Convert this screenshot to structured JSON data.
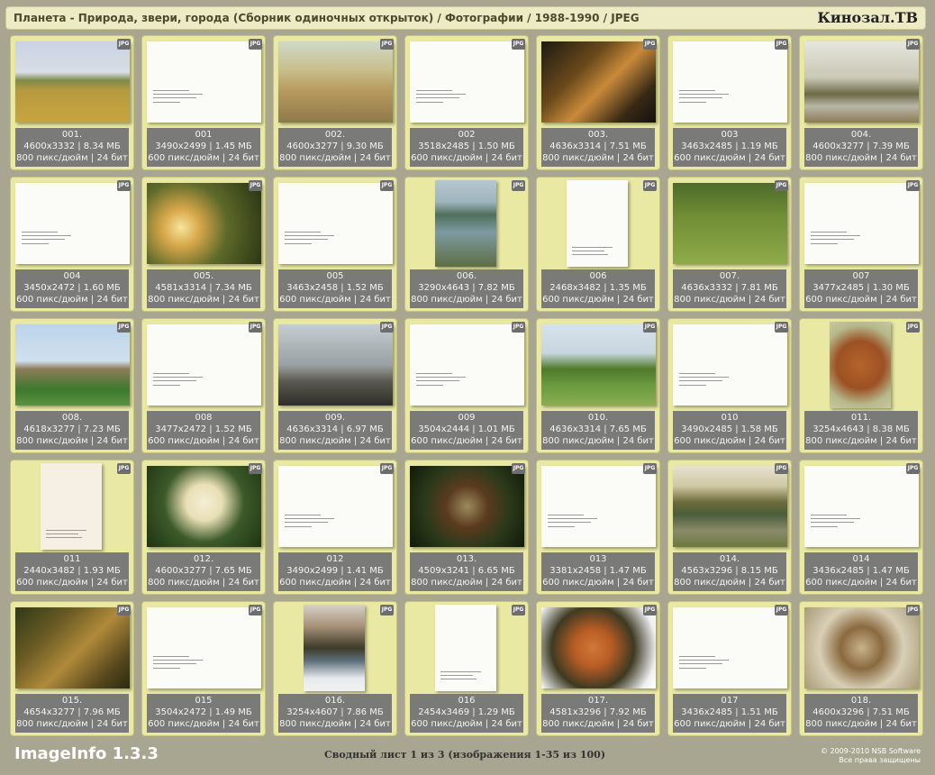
{
  "header": {
    "title": "Планета - Природа, звери, города (Сборник одиночных открыток) / Фотографии / 1988-1990 / JPEG",
    "brand": "Кинозал.ТВ"
  },
  "badge_label": "JPG",
  "colors": {
    "background": "#a8a690",
    "cell": "#e9e9a3",
    "info_bar": "#7a7a78",
    "header": "#ecebc4"
  },
  "items": [
    {
      "name": "001.",
      "dims": "4600x3332 | 8.34 МБ",
      "meta": "800 пикс/дюйм | 24 бит",
      "kind": "photo",
      "orient": "land",
      "subject": "field-tree"
    },
    {
      "name": "001",
      "dims": "3490x2499 | 1.45 МБ",
      "meta": "600 пикс/дюйм | 24 бит",
      "kind": "back",
      "orient": "land"
    },
    {
      "name": "002.",
      "dims": "4600x3277 | 9.30 МБ",
      "meta": "800 пикс/дюйм | 24 бит",
      "kind": "photo",
      "orient": "land",
      "subject": "rocks"
    },
    {
      "name": "002",
      "dims": "3518x2485 | 1.50 МБ",
      "meta": "600 пикс/дюйм | 24 бит",
      "kind": "back",
      "orient": "land"
    },
    {
      "name": "003.",
      "dims": "4636x3314 | 7.51 МБ",
      "meta": "800 пикс/дюйм | 24 бит",
      "kind": "photo",
      "orient": "land",
      "subject": "tigers"
    },
    {
      "name": "003",
      "dims": "3463x2485 | 1.19 МБ",
      "meta": "600 пикс/дюйм | 24 бит",
      "kind": "back",
      "orient": "land"
    },
    {
      "name": "004.",
      "dims": "4600x3277 | 7.39 МБ",
      "meta": "800 пикс/дюйм | 24 бит",
      "kind": "photo",
      "orient": "land",
      "subject": "spring-tree"
    },
    {
      "name": "004",
      "dims": "3450x2472 | 1.60 МБ",
      "meta": "600 пикс/дюйм | 24 бит",
      "kind": "back",
      "orient": "land"
    },
    {
      "name": "005.",
      "dims": "4581x3314 | 7.34 МБ",
      "meta": "800 пикс/дюйм | 24 бит",
      "kind": "photo",
      "orient": "land",
      "subject": "sunny-forest"
    },
    {
      "name": "005",
      "dims": "3463x2458 | 1.52 МБ",
      "meta": "600 пикс/дюйм | 24 бит",
      "kind": "back",
      "orient": "land"
    },
    {
      "name": "006.",
      "dims": "3290x4643 | 7.82 МБ",
      "meta": "800 пикс/дюйм | 24 бит",
      "kind": "photo",
      "orient": "port",
      "subject": "lake-boat"
    },
    {
      "name": "006",
      "dims": "2468x3482 | 1.35 МБ",
      "meta": "600 пикс/дюйм | 24 бит",
      "kind": "back",
      "orient": "port"
    },
    {
      "name": "007.",
      "dims": "4636x3332 | 7.81 МБ",
      "meta": "800 пикс/дюйм | 24 бит",
      "kind": "photo",
      "orient": "land",
      "subject": "dog"
    },
    {
      "name": "007",
      "dims": "3477x2485 | 1.30 МБ",
      "meta": "600 пикс/дюйм | 24 бит",
      "kind": "back",
      "orient": "land"
    },
    {
      "name": "008.",
      "dims": "4618x3277 | 7.23 МБ",
      "meta": "800 пикс/дюйм | 24 бит",
      "kind": "photo",
      "orient": "land",
      "subject": "city-church"
    },
    {
      "name": "008",
      "dims": "3477x2472 | 1.52 МБ",
      "meta": "600 пикс/дюйм | 24 бит",
      "kind": "back",
      "orient": "land"
    },
    {
      "name": "009.",
      "dims": "4636x3314 | 6.97 МБ",
      "meta": "800 пикс/дюйм | 24 бит",
      "kind": "photo",
      "orient": "land",
      "subject": "monument"
    },
    {
      "name": "009",
      "dims": "3504x2444 | 1.01 МБ",
      "meta": "600 пикс/дюйм | 24 бит",
      "kind": "back",
      "orient": "land"
    },
    {
      "name": "010.",
      "dims": "4636x3314 | 7.65 МБ",
      "meta": "800 пикс/дюйм | 24 бит",
      "kind": "photo",
      "orient": "land",
      "subject": "meadow-trees"
    },
    {
      "name": "010",
      "dims": "3490x2485 | 1.58 МБ",
      "meta": "600 пикс/дюйм | 24 бит",
      "kind": "back",
      "orient": "land"
    },
    {
      "name": "011.",
      "dims": "3254x4643 | 8.38 МБ",
      "meta": "800 пикс/дюйм | 24 бит",
      "kind": "photo",
      "orient": "port",
      "subject": "poodle"
    },
    {
      "name": "011",
      "dims": "2440x3482 | 1.93 МБ",
      "meta": "600 пикс/дюйм | 24 бит",
      "kind": "back",
      "orient": "port",
      "tint": "#f6efe4"
    },
    {
      "name": "012.",
      "dims": "4600x3277 | 7.65 МБ",
      "meta": "800 пикс/дюйм | 24 бит",
      "kind": "photo",
      "orient": "land",
      "subject": "butterfly"
    },
    {
      "name": "012",
      "dims": "3490x2499 | 1.41 МБ",
      "meta": "600 пикс/дюйм | 24 бит",
      "kind": "back",
      "orient": "land"
    },
    {
      "name": "013.",
      "dims": "4509x3241 | 6.65 МБ",
      "meta": "800 пикс/дюйм | 24 бит",
      "kind": "photo",
      "orient": "land",
      "subject": "pheasant"
    },
    {
      "name": "013",
      "dims": "3381x2458 | 1.47 МБ",
      "meta": "600 пикс/дюйм | 24 бит",
      "kind": "back",
      "orient": "land"
    },
    {
      "name": "014.",
      "dims": "4563x3296 | 8.15 МБ",
      "meta": "800 пикс/дюйм | 24 бит",
      "kind": "photo",
      "orient": "land",
      "subject": "forest-pond"
    },
    {
      "name": "014",
      "dims": "3436x2485 | 1.47 МБ",
      "meta": "600 пикс/дюйм | 24 бит",
      "kind": "back",
      "orient": "land"
    },
    {
      "name": "015.",
      "dims": "4654x3277 | 7.96 МБ",
      "meta": "800 пикс/дюйм | 24 бит",
      "kind": "photo",
      "orient": "land",
      "subject": "autumn-path"
    },
    {
      "name": "015",
      "dims": "3504x2472 | 1.49 МБ",
      "meta": "600 пикс/дюйм | 24 бит",
      "kind": "back",
      "orient": "land"
    },
    {
      "name": "016.",
      "dims": "3254x4607 | 7.86 МБ",
      "meta": "800 пикс/дюйм | 24 бит",
      "kind": "photo",
      "orient": "port",
      "subject": "winter-river"
    },
    {
      "name": "016",
      "dims": "2454x3469 | 1.29 МБ",
      "meta": "600 пикс/дюйм | 24 бит",
      "kind": "back",
      "orient": "port"
    },
    {
      "name": "017.",
      "dims": "4581x3296 | 7.92 МБ",
      "meta": "800 пикс/дюйм | 24 бит",
      "kind": "photo",
      "orient": "land",
      "subject": "fox"
    },
    {
      "name": "017",
      "dims": "3436x2485 | 1.51 МБ",
      "meta": "600 пикс/дюйм | 24 бит",
      "kind": "back",
      "orient": "land"
    },
    {
      "name": "018.",
      "dims": "4600x3296 | 7.51 МБ",
      "meta": "800 пикс/дюйм | 24 бит",
      "kind": "photo",
      "orient": "land",
      "subject": "chipmunk"
    }
  ],
  "footer": {
    "app": "ImageInfo 1.3.3",
    "sheet": "Сводный лист 1 из 3 (изображения 1-35 из 100)",
    "copyright": "© 2009-2010 NSB Software",
    "rights": "Все права защищены"
  }
}
